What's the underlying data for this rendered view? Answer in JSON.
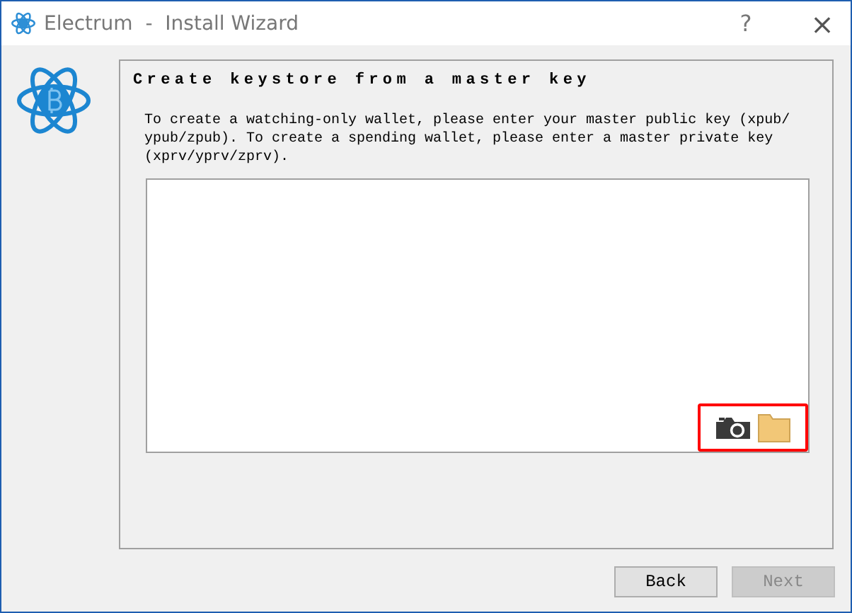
{
  "window": {
    "title": "Electrum  -  Install Wizard",
    "help": "?",
    "close": "×"
  },
  "heading": "Create keystore from a master key",
  "description": "To create a watching-only wallet, please enter your master public key (xpub/ ypub/zpub). To create a spending wallet, please enter a master private key (xprv/yprv/zprv).",
  "key_field": {
    "icons_highlighted": true
  },
  "buttons": [
    {
      "label": "Back",
      "disabled": false
    },
    {
      "label": "Next",
      "disabled": true
    }
  ]
}
